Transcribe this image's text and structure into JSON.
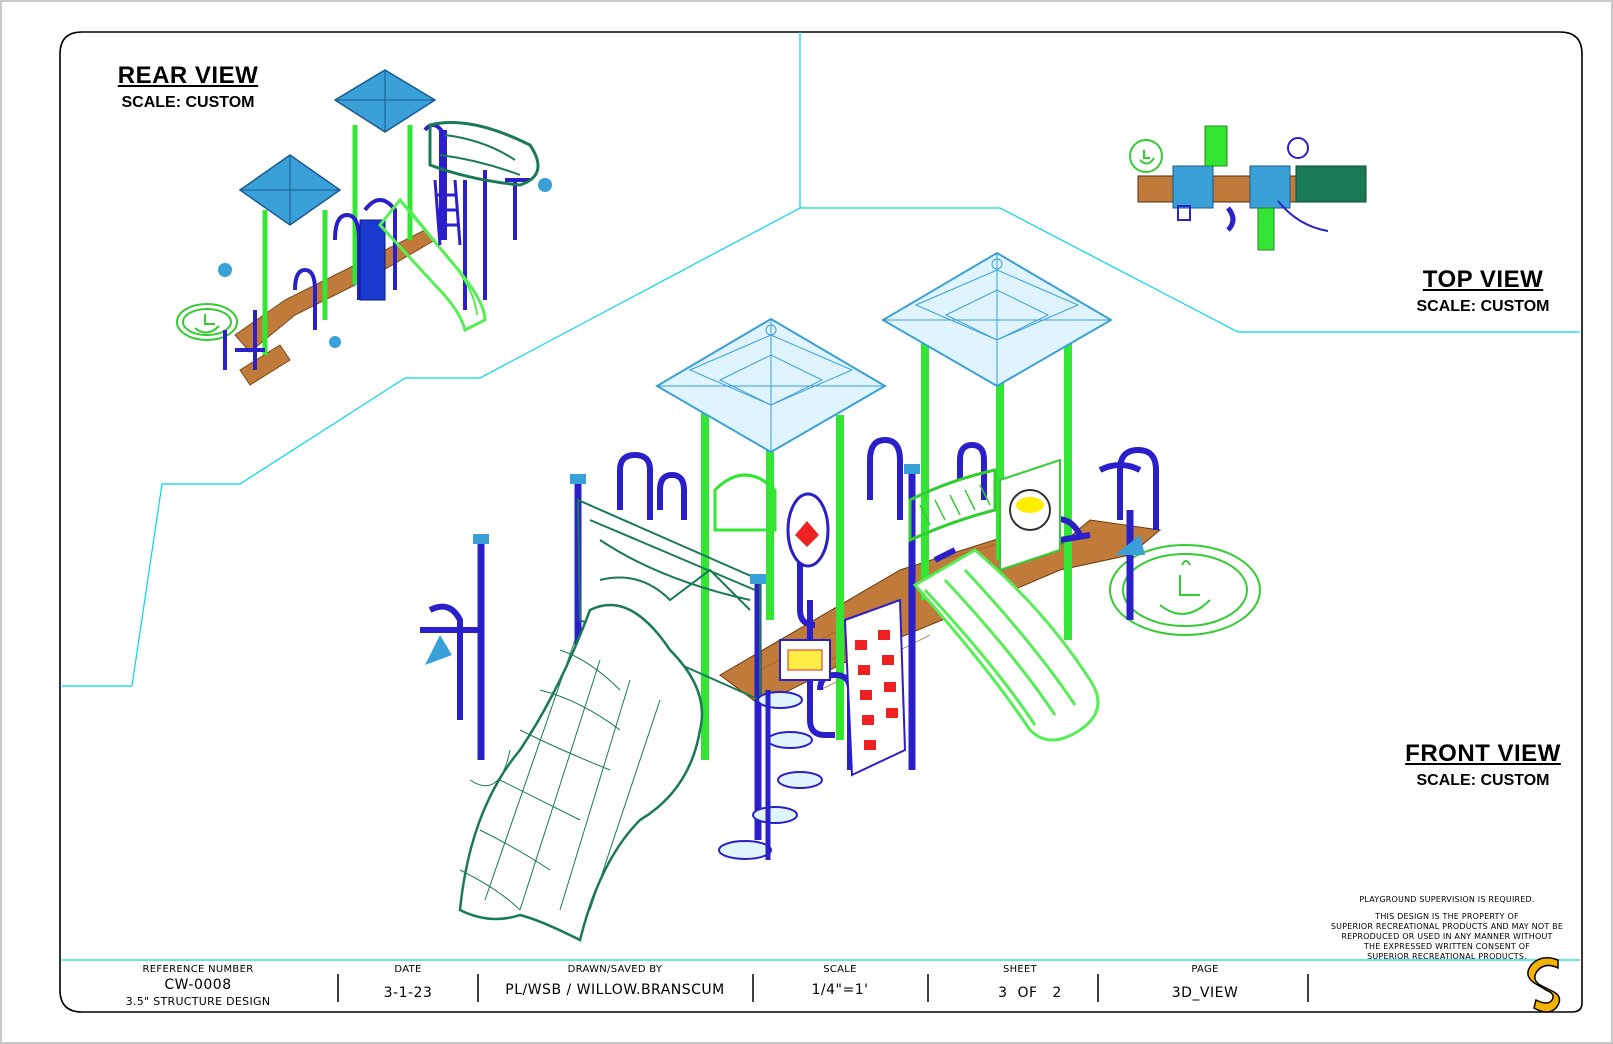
{
  "views": {
    "rear": {
      "title": "REAR VIEW",
      "scale": "SCALE: CUSTOM"
    },
    "top": {
      "title": "TOP VIEW",
      "scale": "SCALE: CUSTOM"
    },
    "front": {
      "title": "FRONT VIEW",
      "scale": "SCALE: CUSTOM"
    }
  },
  "notes": {
    "supervision": "PLAYGROUND SUPERVISION IS REQUIRED.",
    "property": [
      "THIS DESIGN IS THE PROPERTY OF",
      "SUPERIOR RECREATIONAL PRODUCTS AND MAY NOT BE",
      "REPRODUCED OR USED IN ANY MANNER WITHOUT",
      "THE EXPRESSED WRITTEN CONSENT OF",
      "SUPERIOR RECREATIONAL PRODUCTS."
    ]
  },
  "title_block": {
    "reference_label": "REFERENCE NUMBER",
    "reference_value": "CW-0008",
    "reference_sub": "3.5\" STRUCTURE DESIGN",
    "date_label": "DATE",
    "date_value": "3-1-23",
    "drawn_label": "DRAWN/SAVED BY",
    "drawn_value": "PL/WSB / WILLOW.BRANSCUM",
    "scale_label": "SCALE",
    "scale_value": "1/4\"=1'",
    "sheet_label": "SHEET",
    "sheet_value": "3  OF   2",
    "page_label": "PAGE",
    "page_value": "3D_VIEW"
  },
  "colors": {
    "border": "#00d8e8",
    "roof": "#3aa0d8",
    "post_green": "#33e633",
    "rail_blue": "#2a1fc8",
    "deck": "#c07a3a",
    "tube_slide": "#1a7a55",
    "slide_green": "#55ee55",
    "logo_yellow": "#f2b400"
  },
  "icons": [
    "accessibility-symbol-icon",
    "superior-logo-icon"
  ]
}
